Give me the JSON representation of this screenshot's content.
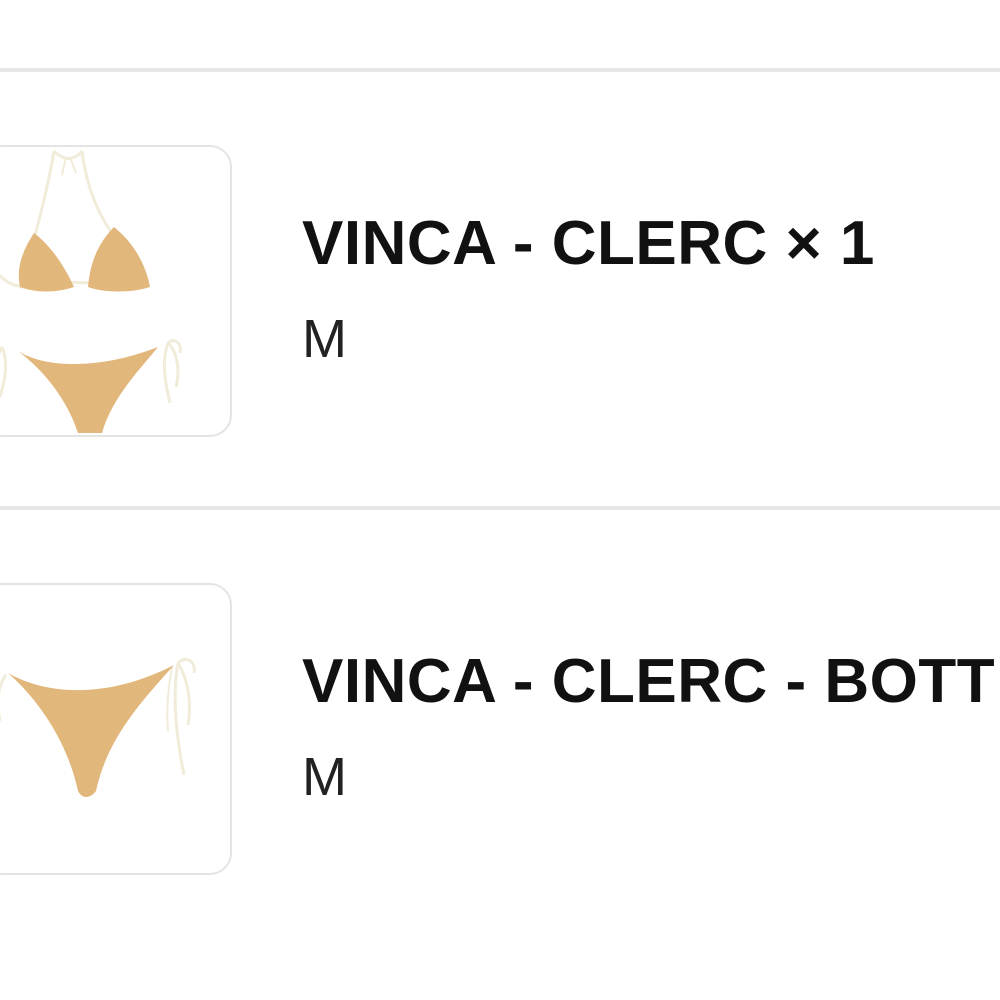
{
  "order_items": [
    {
      "name": "VINCA - CLERC",
      "quantity_text": "× 1",
      "variant": "M",
      "image": "bikini-set-image"
    },
    {
      "name": "VINCA - CLERC - BOTT",
      "variant": "M",
      "image": "bikini-bottom-image"
    }
  ],
  "colors": {
    "swimsuit": "#e2b77c",
    "straps": "#f1ecd9",
    "divider": "#e6e6e6",
    "thumb_border": "#e4e4e4"
  }
}
